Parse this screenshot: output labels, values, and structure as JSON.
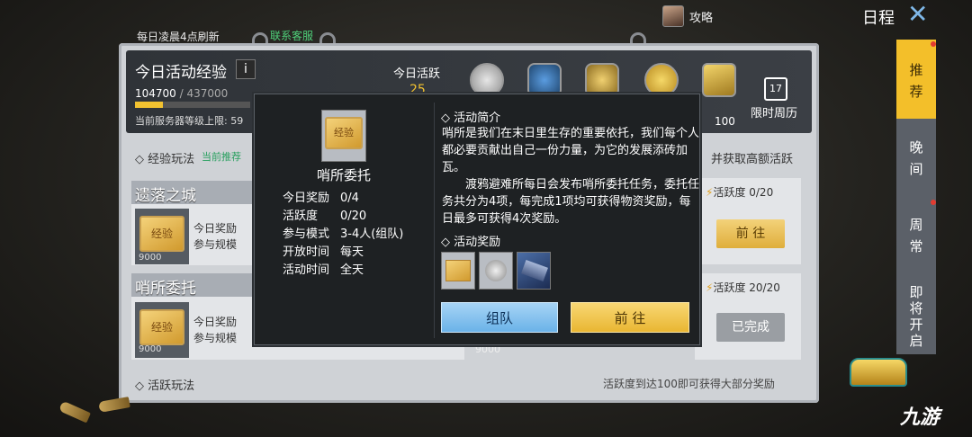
{
  "topbar": {
    "refresh_text": "每日凌晨4点刷新",
    "customer_service": "联系客服",
    "guide_label": "攻略",
    "schedule_title": "日程",
    "close_icon": "close-icon"
  },
  "header": {
    "title": "今日活动经验",
    "info_glyph": "i",
    "exp_current": "104700",
    "exp_sep": " / ",
    "exp_max": "437000",
    "exp_progress": 0.24,
    "server_level_label": "当前服务器等级上限: 59",
    "today_active_label": "今日活跃",
    "today_active_value": "25",
    "reward_value": "100",
    "calendar_day": "17",
    "weekly_limit": "限时周历"
  },
  "list": {
    "section_title": "经验玩法",
    "recommend_badge": "当前推荐",
    "high_active_hint": "并获取高额活跃",
    "cards": [
      {
        "title": "遗落之城",
        "ticket_label": "经验",
        "count": "9000",
        "reward_label": "今日奖励",
        "scale_label": "参与规模",
        "active_text": "活跃度  0/20",
        "button": "前 往"
      },
      {
        "title": "哨所委托",
        "ticket_label": "经验",
        "count": "9000",
        "reward_label": "今日奖励",
        "scale_label": "参与规模",
        "active_text": "活跃度 20/20",
        "button": "已完成"
      }
    ],
    "hidden_count": "9000",
    "footer_title": "活跃玩法",
    "footer_tip": "活跃度到达100即可获得大部分奖励"
  },
  "popup": {
    "ticket_label": "经验",
    "name": "哨所委托",
    "fields": [
      {
        "key": "今日奖励",
        "value": "0/4"
      },
      {
        "key": "活跃度",
        "value": "0/20"
      },
      {
        "key": "参与模式",
        "value": "3-4人(组队)"
      },
      {
        "key": "开放时间",
        "value": "每天"
      },
      {
        "key": "活动时间",
        "value": "全天"
      }
    ],
    "intro_title": "活动简介",
    "intro_p1": "哨所是我们在末日里生存的重要依托，我们每个人都必要贡献出自己一份力量，为它的发展添砖加瓦。",
    "intro_p2": "渡鸦避难所每日会发布哨所委托任务，委托任务共分为4项，每完成1项均可获得物资奖励，每日最多可获得4次奖励。",
    "reward_title": "活动奖励",
    "rewards": [
      "exp-ticket-icon",
      "silver-coin-icon",
      "vehicle-icon"
    ],
    "team_button": "组队",
    "go_button": "前 往"
  },
  "sidebar": {
    "items": [
      {
        "label": "推\n荐",
        "active": true
      },
      {
        "label": "晚\n间",
        "active": false
      },
      {
        "label": "周\n常",
        "active": false
      },
      {
        "label": "即\n将\n开\n启",
        "active": false
      }
    ]
  },
  "watermark": "九游",
  "colors": {
    "accent_gold": "#f3bf2a",
    "team_blue": "#6ab2e8",
    "recommend_green": "#2aa060"
  }
}
